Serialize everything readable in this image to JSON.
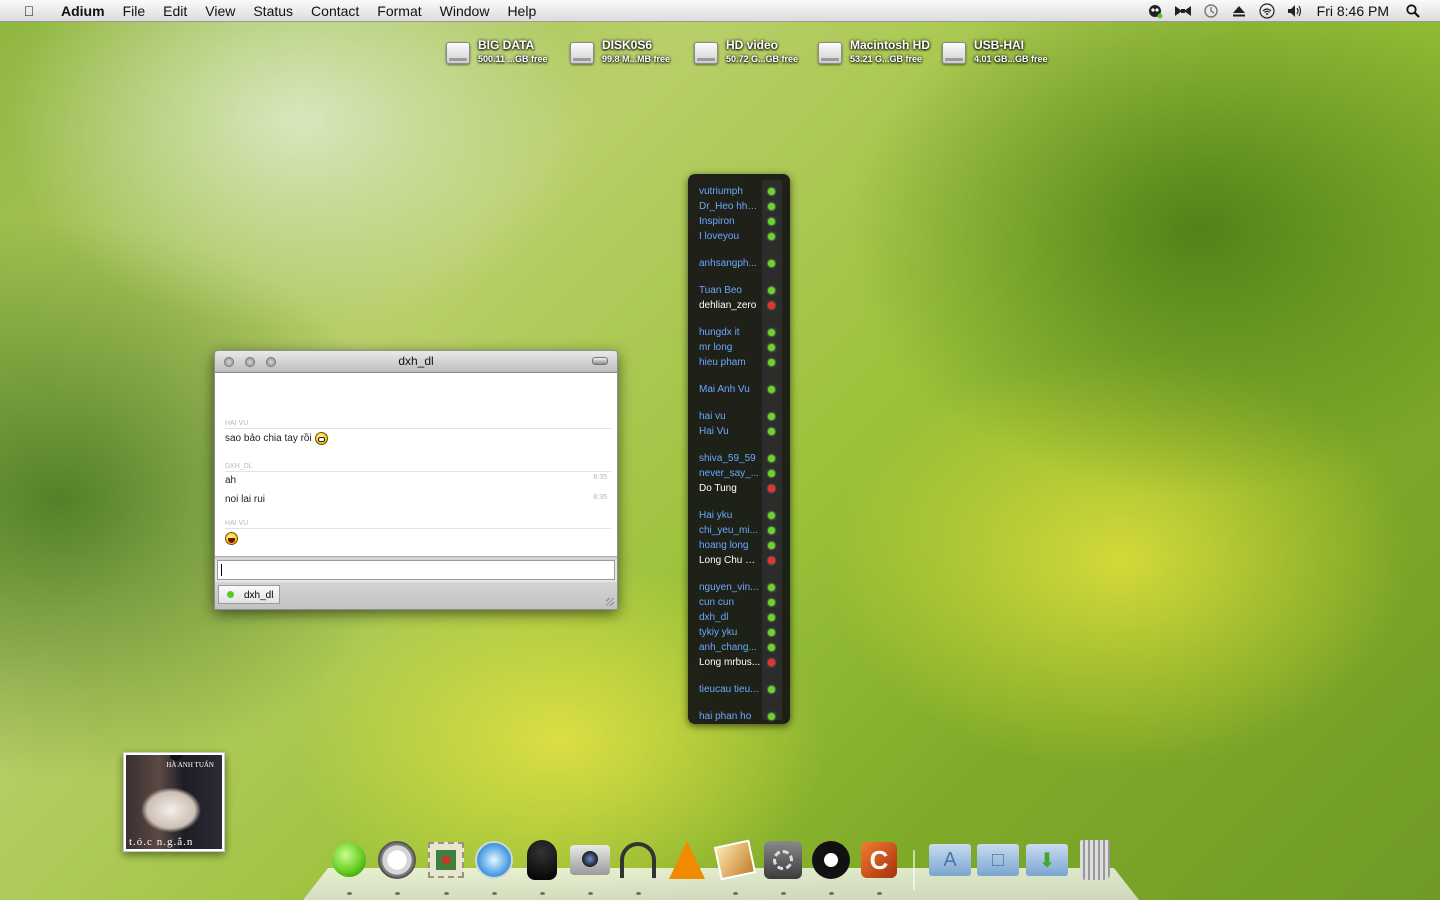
{
  "menubar": {
    "app_name": "Adium",
    "items": [
      "File",
      "Edit",
      "View",
      "Status",
      "Contact",
      "Format",
      "Window",
      "Help"
    ],
    "clock": "Fri 8:46 PM"
  },
  "drives": [
    {
      "name": "BIG DATA",
      "free": "500.11 ...GB free"
    },
    {
      "name": "DISK0S6",
      "free": "99.8 M...MB free"
    },
    {
      "name": "HD video",
      "free": "50.72 G...GB free"
    },
    {
      "name": "Macintosh HD",
      "free": "53.21 G...GB free"
    },
    {
      "name": "USB-HAI",
      "free": "4.01 GB...GB free"
    }
  ],
  "contacts": [
    {
      "name": "vutriumph",
      "status": "online"
    },
    {
      "name": "Dr_Heo hhh...",
      "status": "online"
    },
    {
      "name": "Inspiron",
      "status": "online"
    },
    {
      "name": "I loveyou",
      "status": "online"
    },
    {
      "name": "anhsangph...",
      "status": "online"
    },
    {
      "name": "Tuan Beo",
      "status": "online"
    },
    {
      "name": "dehlian_zero",
      "status": "away"
    },
    {
      "name": "hungdx it",
      "status": "online"
    },
    {
      "name": "mr long",
      "status": "online"
    },
    {
      "name": "hieu pham",
      "status": "online"
    },
    {
      "name": "Mai Anh Vu",
      "status": "online"
    },
    {
      "name": "hai vu",
      "status": "online"
    },
    {
      "name": "Hai Vu",
      "status": "online"
    },
    {
      "name": "shiva_59_59",
      "status": "online"
    },
    {
      "name": "never_say_...",
      "status": "online"
    },
    {
      "name": "Do Tung",
      "status": "away"
    },
    {
      "name": "Hai yku",
      "status": "online"
    },
    {
      "name": "chi_yeu_mi...",
      "status": "online"
    },
    {
      "name": "hoang long",
      "status": "online"
    },
    {
      "name": "Long Chu Huy",
      "status": "away"
    },
    {
      "name": "nguyen_vin...",
      "status": "online"
    },
    {
      "name": "cun cun",
      "status": "online"
    },
    {
      "name": "dxh_dl",
      "status": "online"
    },
    {
      "name": "tykiy yku",
      "status": "online"
    },
    {
      "name": "anh_chang...",
      "status": "online"
    },
    {
      "name": "Long mrbus...",
      "status": "away"
    },
    {
      "name": "tieucau tieu...",
      "status": "online"
    },
    {
      "name": "hai phan ho",
      "status": "online"
    }
  ],
  "chat": {
    "title": "dxh_dl",
    "messages": [
      {
        "sender": "HAI VU",
        "text": "sao bảo chia tay rồi",
        "time": ""
      },
      {
        "sender": "DXH_DL",
        "text": "ah",
        "time": "8:35"
      },
      {
        "sender": "",
        "text": "noi lai rui",
        "time": "8:35"
      },
      {
        "sender": "HAI VU",
        "text": "",
        "time": ""
      }
    ],
    "input_value": "",
    "tab_label": "dxh_dl"
  },
  "album": {
    "cover_text": "t.ó.c n.g.ắ.n",
    "top_text": "HÀ ANH TUẤN"
  },
  "dock": {
    "items": [
      "finder-icon",
      "gauge-icon",
      "stamps-icon",
      "safari-icon",
      "adium-icon",
      "photo-booth-icon",
      "headphones-icon",
      "vlc-icon",
      "iphoto-icon",
      "system-preferences-icon",
      "bowtie-icon",
      "coda-icon",
      "applications-folder-icon",
      "documents-folder-icon",
      "downloads-folder-icon",
      "trash-icon"
    ]
  },
  "colors": {
    "online": "#6dd42c",
    "away": "#e8322c",
    "contact_online_text": "#6aa8ff"
  }
}
